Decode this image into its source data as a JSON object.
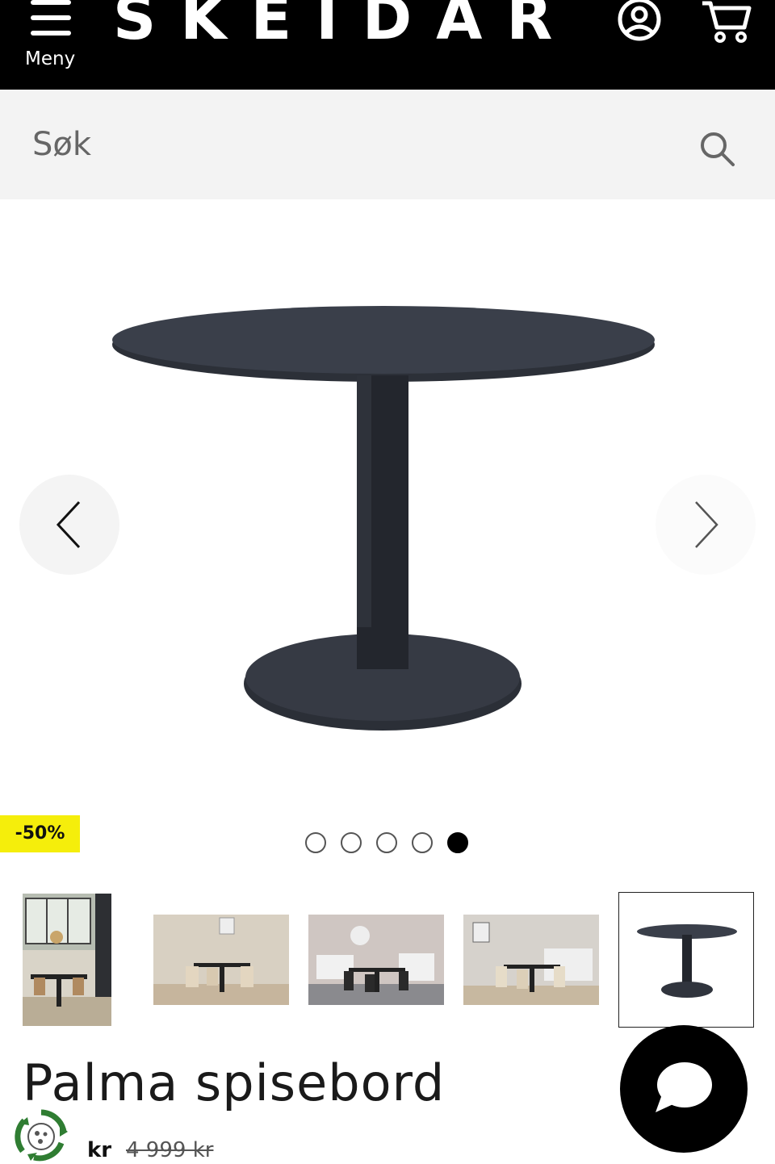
{
  "header": {
    "menu_label": "Meny",
    "logo_text": "SKEIDAR",
    "background": "#000000"
  },
  "search": {
    "placeholder": "Søk"
  },
  "gallery": {
    "discount_badge": "-50%",
    "badge_color": "#f5ee0b",
    "slide_count": 5,
    "active_slide": 5,
    "thumbnails": [
      {
        "label": "Rom med spisebord og stoler",
        "selected": false
      },
      {
        "label": "Spisebord med stoler",
        "selected": false
      },
      {
        "label": "Spisebord i stue",
        "selected": false
      },
      {
        "label": "Spisebord med beige stoler",
        "selected": false
      },
      {
        "label": "Spisebord produktbilde",
        "selected": true
      }
    ]
  },
  "product": {
    "title": "Palma spisebord",
    "price_currency": "kr",
    "old_price": "4 999 kr"
  }
}
